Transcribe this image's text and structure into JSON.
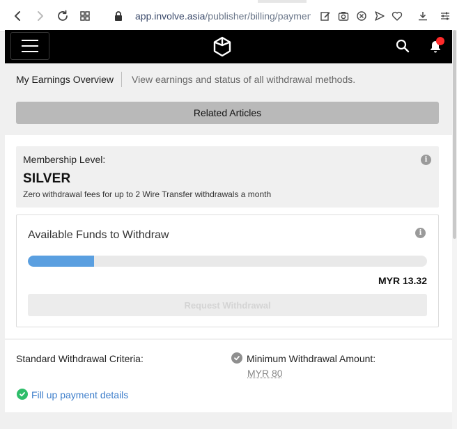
{
  "browser": {
    "url_host": "app.involve.asia",
    "url_path": "/publisher/billing/payment-h"
  },
  "overview": {
    "title": "My Earnings Overview",
    "description": "View earnings and status of all withdrawal methods.",
    "related_label": "Related Articles"
  },
  "membership": {
    "label": "Membership Level:",
    "level": "SILVER",
    "note": "Zero withdrawal fees for up to 2 Wire Transfer withdrawals a month",
    "info_glyph": "i"
  },
  "funds": {
    "title": "Available Funds to Withdraw",
    "amount": "MYR 13.32",
    "progress_fraction": 0.1665,
    "withdraw_label": "Request Withdrawal",
    "info_glyph": "i"
  },
  "criteria": {
    "title": "Standard Withdrawal Criteria:",
    "min_label": "Minimum Withdrawal Amount:",
    "min_value": "MYR 80",
    "payment_link": "Fill up payment details"
  },
  "colors": {
    "progress_fill": "#5a9fe0",
    "notification_dot": "#ff2a2a",
    "check_done": "#2ebd6a",
    "check_pending": "#8f8f8f",
    "link": "#3d7ecb"
  },
  "icons": [
    "back-arrow-icon",
    "forward-arrow-icon",
    "reload-icon",
    "grid-icon",
    "lock-icon",
    "edit-icon",
    "camera-icon",
    "close-circle-icon",
    "send-icon",
    "heart-icon",
    "download-icon",
    "settings-sliders-icon",
    "hamburger-menu-icon",
    "logo-icon",
    "search-icon",
    "bell-icon",
    "info-icon",
    "check-circle-icon"
  ]
}
